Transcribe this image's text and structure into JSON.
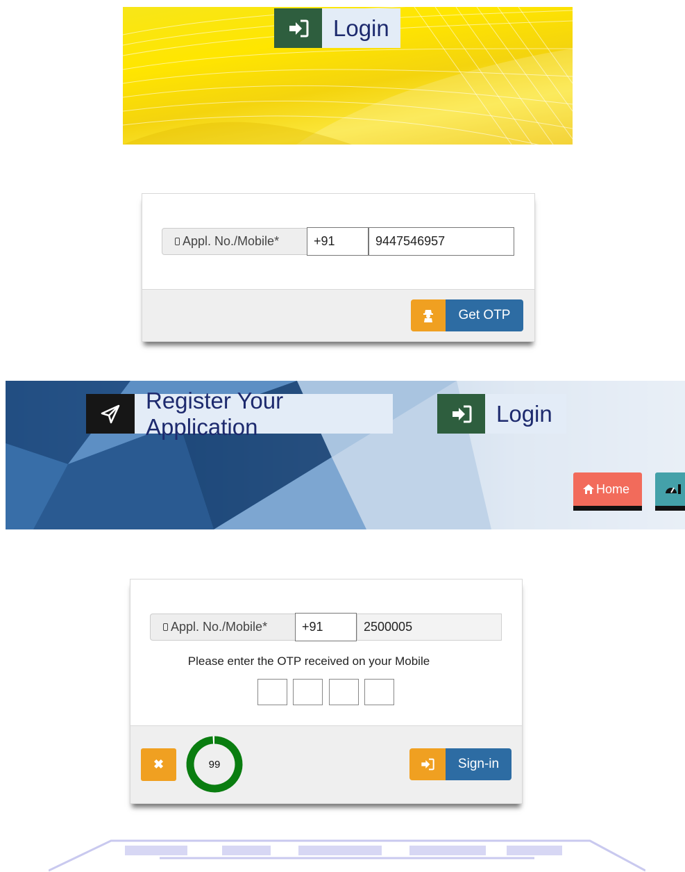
{
  "section1": {
    "banner": {
      "login_label": "Login"
    },
    "form": {
      "appl_label": "Appl. No./Mobile*",
      "country_code": "+91",
      "mobile_value": "9447546957",
      "get_otp_label": "Get OTP"
    }
  },
  "section2": {
    "banner": {
      "register_label": "Register Your Application",
      "login_label": "Login",
      "nav_home": "Home"
    },
    "form": {
      "appl_label": "Appl. No./Mobile*",
      "country_code": "+91",
      "mobile_value": "2500005",
      "otp_prompt": "Please enter the OTP received on your Mobile",
      "otp_digits": [
        "",
        "",
        "",
        ""
      ],
      "timer_value": "99",
      "timer_fraction": 0.99,
      "signin_label": "Sign-in",
      "close_symbol": "✖"
    }
  },
  "colors": {
    "accent_orange": "#f0a021",
    "button_blue": "#2d6ca3",
    "login_icon_green": "#2e5e3e",
    "home_red": "#f26b5b",
    "dashboard_teal": "#44a1a9",
    "timer_green": "#0a7d10"
  },
  "icons": {
    "login": "sign-in-icon",
    "register": "paper-plane-icon",
    "home": "home-icon",
    "dashboard": "dashboard-icon",
    "phone": "mobile-phone-icon",
    "otp": "user-secret-icon",
    "close": "close-icon"
  }
}
